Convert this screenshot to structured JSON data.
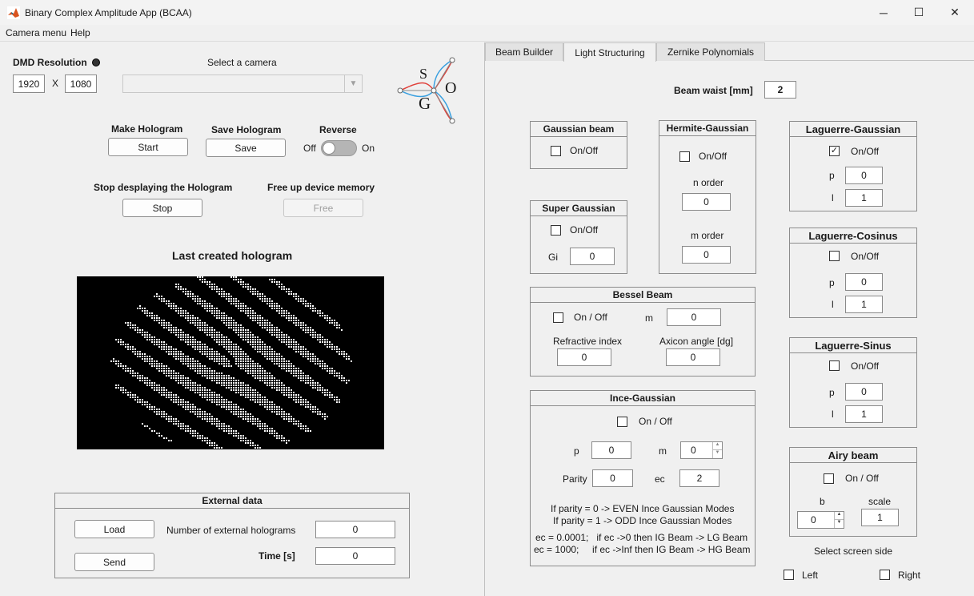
{
  "window": {
    "title": "Binary Complex Amplitude App (BCAA)",
    "minimize_glyph": "─",
    "maximize_glyph": "☐",
    "close_glyph": "✕"
  },
  "menu": {
    "camera": "Camera menu",
    "help": "Help"
  },
  "left": {
    "dmd_label": "DMD Resolution",
    "dmd_width": "1920",
    "dmd_x": "X",
    "dmd_height": "1080",
    "camera_label": "Select a camera",
    "camera_value": "",
    "make_hologram_label": "Make Hologram",
    "start_label": "Start",
    "save_hologram_label": "Save Hologram",
    "save_label": "Save",
    "reverse_label": "Reverse",
    "off_label": "Off",
    "on_label": "On",
    "stop_display_label": "Stop desplaying the Hologram",
    "stop_label": "Stop",
    "free_memory_label": "Free up device memory",
    "free_label": "Free",
    "last_hologram_label": "Last created hologram"
  },
  "external": {
    "title": "External data",
    "load_label": "Load",
    "send_label": "Send",
    "count_label": "Number of external holograms",
    "count_value": "0",
    "time_label": "Time [s]",
    "time_value": "0"
  },
  "logo": {
    "letters": [
      "S",
      "O",
      "G"
    ]
  },
  "tabs": [
    "Beam Builder",
    "Light Structuring",
    "Zernike Polynomials"
  ],
  "beam_waist": {
    "label": "Beam waist [mm]",
    "value": "2"
  },
  "gaussian": {
    "title": "Gaussian beam",
    "toggle": "On/Off"
  },
  "super_gaussian": {
    "title": "Super Gaussian",
    "toggle": "On/Off",
    "gi_label": "Gi",
    "gi_value": "0"
  },
  "hermite": {
    "title": "Hermite-Gaussian",
    "toggle": "On/Off",
    "n_label": "n order",
    "n_value": "0",
    "m_label": "m order",
    "m_value": "0"
  },
  "laguerre_gaussian": {
    "title": "Laguerre-Gaussian",
    "toggle": "On/Off",
    "p_label": "p",
    "p_value": "0",
    "l_label": "l",
    "l_value": "1",
    "check": "✓"
  },
  "laguerre_cosinus": {
    "title": "Laguerre-Cosinus",
    "toggle": "On/Off",
    "p_label": "p",
    "p_value": "0",
    "l_label": "l",
    "l_value": "1"
  },
  "laguerre_sinus": {
    "title": "Laguerre-Sinus",
    "toggle": "On/Off",
    "p_label": "p",
    "p_value": "0",
    "l_label": "l",
    "l_value": "1"
  },
  "bessel": {
    "title": "Bessel Beam",
    "toggle": "On / Off",
    "m_label": "m",
    "m_value": "0",
    "ri_label": "Refractive index",
    "ri_value": "0",
    "axicon_label": "Axicon angle [dg]",
    "axicon_value": "0"
  },
  "ince": {
    "title": "Ince-Gaussian",
    "toggle": "On / Off",
    "p_label": "p",
    "p_value": "0",
    "m_label": "m",
    "m_value": "0",
    "parity_label": "Parity",
    "parity_value": "0",
    "ec_label": "ec",
    "ec_value": "2",
    "note1": "If parity = 0 -> EVEN Ince Gaussian Modes",
    "note2": "If parity = 1 -> ODD Ince Gaussian Modes",
    "note3": "ec = 0.0001;   if ec ->0 then IG Beam -> LG Beam",
    "note4": "ec = 1000;     if ec ->Inf then IG Beam -> HG Beam"
  },
  "airy": {
    "title": "Airy beam",
    "toggle": "On / Off",
    "b_label": "b",
    "b_value": "0",
    "scale_label": "scale",
    "scale_value": "1"
  },
  "screen_side": {
    "label": "Select screen side",
    "left": "Left",
    "right": "Right"
  },
  "colors": {
    "accent": "#0078d7"
  }
}
